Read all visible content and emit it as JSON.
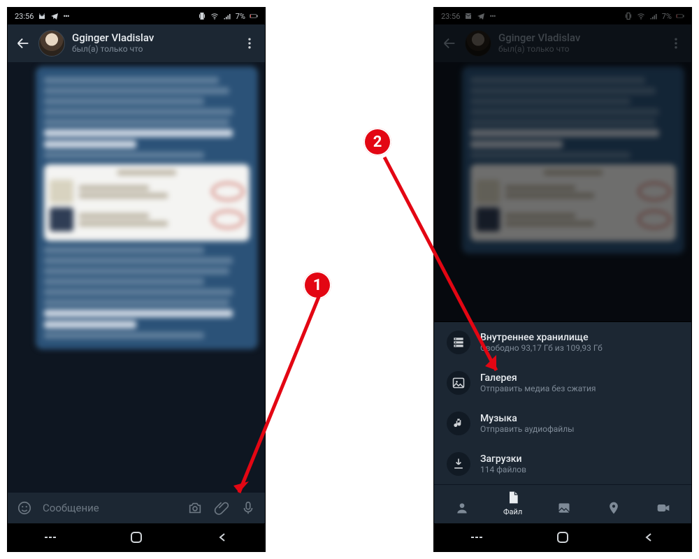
{
  "statusbar": {
    "time": "23:56",
    "battery": "7%"
  },
  "header": {
    "name": "Gginger Vladislav",
    "status": "был(а) только что"
  },
  "inputbar": {
    "placeholder": "Сообщение"
  },
  "sheet": {
    "items": [
      {
        "title": "Внутреннее хранилище",
        "sub": "Свободно 93,17 Гб из 109,93 Гб"
      },
      {
        "title": "Галерея",
        "sub": "Отправить медиа без сжатия"
      },
      {
        "title": "Музыка",
        "sub": "Отправить аудиофайлы"
      },
      {
        "title": "Загрузки",
        "sub": "114 файлов"
      }
    ],
    "tabs": {
      "file": "Файл"
    }
  },
  "annotations": {
    "badge1": "1",
    "badge2": "2"
  }
}
